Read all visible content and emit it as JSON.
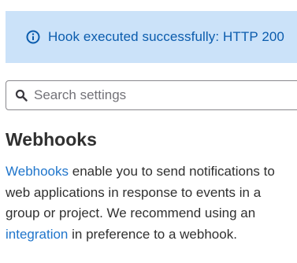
{
  "alert": {
    "icon": "info-circle-icon",
    "message": "Hook executed successfully: HTTP 200",
    "color": "#0b5cad",
    "background": "#cbe2f9"
  },
  "search": {
    "icon": "search-icon",
    "placeholder": "Search settings",
    "value": ""
  },
  "section": {
    "title": "Webhooks",
    "description": {
      "link1_text": "Webhooks",
      "text1": " enable you to send notifications to web applications in response to events in a group or project. We recommend using an ",
      "link2_text": "integration",
      "text2": " in preference to a webhook.",
      "link_color": "#1f75cb"
    }
  }
}
